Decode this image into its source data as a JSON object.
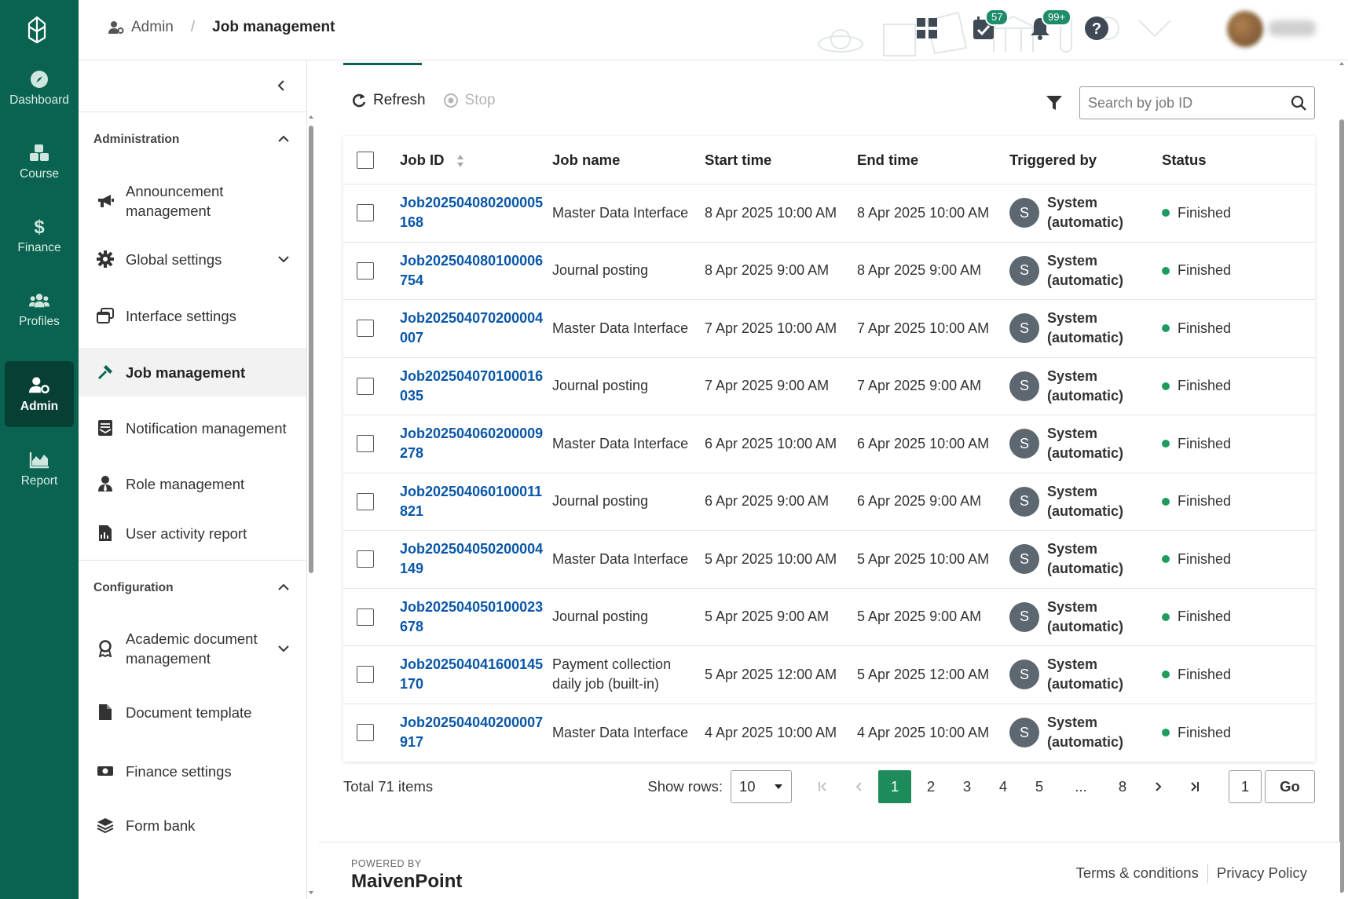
{
  "rail": {
    "items": [
      {
        "label": "Dashboard",
        "icon": "compass-icon"
      },
      {
        "label": "Course",
        "icon": "cubes-icon"
      },
      {
        "label": "Finance",
        "icon": "dollar-icon"
      },
      {
        "label": "Profiles",
        "icon": "users-icon"
      },
      {
        "label": "Admin",
        "icon": "user-gear-icon",
        "active": true
      },
      {
        "label": "Report",
        "icon": "area-chart-icon"
      }
    ]
  },
  "header": {
    "breadcrumb_root": "Admin",
    "breadcrumb_sep": "/",
    "breadcrumb_current": "Job management",
    "tasks_badge": "57",
    "notifications_badge": "99+"
  },
  "sidebar": {
    "sections": [
      {
        "title": "Administration",
        "items": [
          {
            "label": "Announcement management",
            "icon": "megaphone-icon"
          },
          {
            "label": "Global settings",
            "icon": "gear-icon",
            "expandable": true
          },
          {
            "label": "Interface settings",
            "icon": "windows-icon"
          },
          {
            "label": "Job management",
            "icon": "hammer-icon",
            "active": true
          },
          {
            "label": "Notification management",
            "icon": "envelope-list-icon"
          },
          {
            "label": "Role management",
            "icon": "user-tie-icon"
          },
          {
            "label": "User activity report",
            "icon": "file-chart-icon"
          }
        ]
      },
      {
        "title": "Configuration",
        "items": [
          {
            "label": "Academic document management",
            "icon": "award-icon",
            "expandable": true
          },
          {
            "label": "Document template",
            "icon": "file-icon"
          },
          {
            "label": "Finance settings",
            "icon": "money-icon"
          },
          {
            "label": "Form bank",
            "icon": "layers-icon"
          }
        ]
      }
    ]
  },
  "toolbar": {
    "refresh_label": "Refresh",
    "stop_label": "Stop",
    "search_placeholder": "Search by job ID"
  },
  "table": {
    "columns": [
      "Job ID",
      "Job name",
      "Start time",
      "End time",
      "Triggered by",
      "Status"
    ],
    "rows": [
      {
        "id": "Job202504080200005168",
        "name": "Master Data Interface",
        "start": "8 Apr 2025 10:00 AM",
        "end": "8 Apr 2025 10:00 AM",
        "avatar": "S",
        "trigger": "System (automatic)",
        "status": "Finished"
      },
      {
        "id": "Job202504080100006754",
        "name": "Journal posting",
        "start": "8 Apr 2025 9:00 AM",
        "end": "8 Apr 2025 9:00 AM",
        "avatar": "S",
        "trigger": "System (automatic)",
        "status": "Finished"
      },
      {
        "id": "Job202504070200004007",
        "name": "Master Data Interface",
        "start": "7 Apr 2025 10:00 AM",
        "end": "7 Apr 2025 10:00 AM",
        "avatar": "S",
        "trigger": "System (automatic)",
        "status": "Finished"
      },
      {
        "id": "Job202504070100016035",
        "name": "Journal posting",
        "start": "7 Apr 2025 9:00 AM",
        "end": "7 Apr 2025 9:00 AM",
        "avatar": "S",
        "trigger": "System (automatic)",
        "status": "Finished"
      },
      {
        "id": "Job202504060200009278",
        "name": "Master Data Interface",
        "start": "6 Apr 2025 10:00 AM",
        "end": "6 Apr 2025 10:00 AM",
        "avatar": "S",
        "trigger": "System (automatic)",
        "status": "Finished"
      },
      {
        "id": "Job202504060100011821",
        "name": "Journal posting",
        "start": "6 Apr 2025 9:00 AM",
        "end": "6 Apr 2025 9:00 AM",
        "avatar": "S",
        "trigger": "System (automatic)",
        "status": "Finished"
      },
      {
        "id": "Job202504050200004149",
        "name": "Master Data Interface",
        "start": "5 Apr 2025 10:00 AM",
        "end": "5 Apr 2025 10:00 AM",
        "avatar": "S",
        "trigger": "System (automatic)",
        "status": "Finished"
      },
      {
        "id": "Job202504050100023678",
        "name": "Journal posting",
        "start": "5 Apr 2025 9:00 AM",
        "end": "5 Apr 2025 9:00 AM",
        "avatar": "S",
        "trigger": "System (automatic)",
        "status": "Finished"
      },
      {
        "id": "Job202504041600145170",
        "name": "Payment collection daily job (built-in)",
        "start": "5 Apr 2025 12:00 AM",
        "end": "5 Apr 2025 12:00 AM",
        "avatar": "S",
        "trigger": "System (automatic)",
        "status": "Finished"
      },
      {
        "id": "Job202504040200007917",
        "name": "Master Data Interface",
        "start": "4 Apr 2025 10:00 AM",
        "end": "4 Apr 2025 10:00 AM",
        "avatar": "S",
        "trigger": "System (automatic)",
        "status": "Finished"
      }
    ]
  },
  "pagination": {
    "total": "Total 71 items",
    "show_rows_label": "Show rows:",
    "rows_value": "10",
    "pages": [
      "1",
      "2",
      "3",
      "4",
      "5",
      "...",
      "8"
    ],
    "current_page": "1",
    "goto_value": "1",
    "go_label": "Go"
  },
  "footer": {
    "powered_by": "POWERED BY",
    "brand": "MaivenPoint",
    "terms": "Terms & conditions",
    "privacy": "Privacy Policy"
  },
  "colors": {
    "brand_green": "#0a6350",
    "active_page": "#1e8c5a",
    "link_blue": "#0a57a8",
    "status_green": "#1f9b5e"
  }
}
